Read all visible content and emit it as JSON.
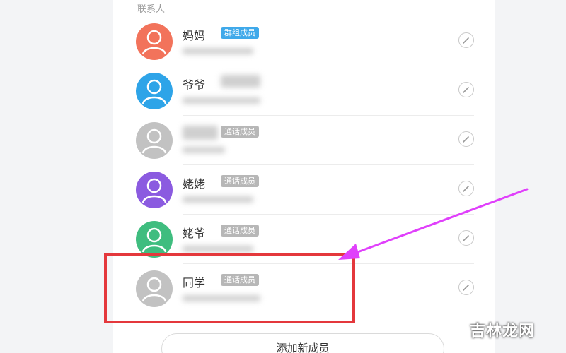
{
  "section_label": "联系人",
  "contacts": [
    {
      "name": "妈妈",
      "badge": "群组成员",
      "avatar_color": "#f2735b",
      "badge_type": "primary"
    },
    {
      "name": "爷爷",
      "badge": "",
      "avatar_color": "#2ea4e8",
      "badge_type": "gray"
    },
    {
      "name": "",
      "badge": "通话成员",
      "avatar_color": "#c2c2c2",
      "badge_type": "gray"
    },
    {
      "name": "姥姥",
      "badge": "通话成员",
      "avatar_color": "#8b5be0",
      "badge_type": "gray"
    },
    {
      "name": "姥爷",
      "badge": "通话成员",
      "avatar_color": "#3fbd7f",
      "badge_type": "gray"
    },
    {
      "name": "同学",
      "badge": "通话成员",
      "avatar_color": "#c2c2c2",
      "badge_type": "gray"
    }
  ],
  "add_button": "添加新成员",
  "watermark": "吉林龙网",
  "colors": {
    "highlight": "#e4383c",
    "arrow": "#e040fb",
    "primary_badge": "#3fa9ea"
  }
}
